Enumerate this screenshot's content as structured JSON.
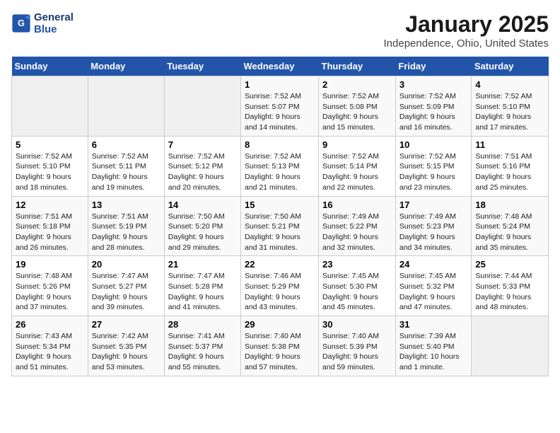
{
  "header": {
    "logo_line1": "General",
    "logo_line2": "Blue",
    "title": "January 2025",
    "subtitle": "Independence, Ohio, United States"
  },
  "days_of_week": [
    "Sunday",
    "Monday",
    "Tuesday",
    "Wednesday",
    "Thursday",
    "Friday",
    "Saturday"
  ],
  "weeks": [
    [
      {
        "num": "",
        "sunrise": "",
        "sunset": "",
        "daylight": ""
      },
      {
        "num": "",
        "sunrise": "",
        "sunset": "",
        "daylight": ""
      },
      {
        "num": "",
        "sunrise": "",
        "sunset": "",
        "daylight": ""
      },
      {
        "num": "1",
        "sunrise": "Sunrise: 7:52 AM",
        "sunset": "Sunset: 5:07 PM",
        "daylight": "Daylight: 9 hours and 14 minutes."
      },
      {
        "num": "2",
        "sunrise": "Sunrise: 7:52 AM",
        "sunset": "Sunset: 5:08 PM",
        "daylight": "Daylight: 9 hours and 15 minutes."
      },
      {
        "num": "3",
        "sunrise": "Sunrise: 7:52 AM",
        "sunset": "Sunset: 5:09 PM",
        "daylight": "Daylight: 9 hours and 16 minutes."
      },
      {
        "num": "4",
        "sunrise": "Sunrise: 7:52 AM",
        "sunset": "Sunset: 5:10 PM",
        "daylight": "Daylight: 9 hours and 17 minutes."
      }
    ],
    [
      {
        "num": "5",
        "sunrise": "Sunrise: 7:52 AM",
        "sunset": "Sunset: 5:10 PM",
        "daylight": "Daylight: 9 hours and 18 minutes."
      },
      {
        "num": "6",
        "sunrise": "Sunrise: 7:52 AM",
        "sunset": "Sunset: 5:11 PM",
        "daylight": "Daylight: 9 hours and 19 minutes."
      },
      {
        "num": "7",
        "sunrise": "Sunrise: 7:52 AM",
        "sunset": "Sunset: 5:12 PM",
        "daylight": "Daylight: 9 hours and 20 minutes."
      },
      {
        "num": "8",
        "sunrise": "Sunrise: 7:52 AM",
        "sunset": "Sunset: 5:13 PM",
        "daylight": "Daylight: 9 hours and 21 minutes."
      },
      {
        "num": "9",
        "sunrise": "Sunrise: 7:52 AM",
        "sunset": "Sunset: 5:14 PM",
        "daylight": "Daylight: 9 hours and 22 minutes."
      },
      {
        "num": "10",
        "sunrise": "Sunrise: 7:52 AM",
        "sunset": "Sunset: 5:15 PM",
        "daylight": "Daylight: 9 hours and 23 minutes."
      },
      {
        "num": "11",
        "sunrise": "Sunrise: 7:51 AM",
        "sunset": "Sunset: 5:16 PM",
        "daylight": "Daylight: 9 hours and 25 minutes."
      }
    ],
    [
      {
        "num": "12",
        "sunrise": "Sunrise: 7:51 AM",
        "sunset": "Sunset: 5:18 PM",
        "daylight": "Daylight: 9 hours and 26 minutes."
      },
      {
        "num": "13",
        "sunrise": "Sunrise: 7:51 AM",
        "sunset": "Sunset: 5:19 PM",
        "daylight": "Daylight: 9 hours and 28 minutes."
      },
      {
        "num": "14",
        "sunrise": "Sunrise: 7:50 AM",
        "sunset": "Sunset: 5:20 PM",
        "daylight": "Daylight: 9 hours and 29 minutes."
      },
      {
        "num": "15",
        "sunrise": "Sunrise: 7:50 AM",
        "sunset": "Sunset: 5:21 PM",
        "daylight": "Daylight: 9 hours and 31 minutes."
      },
      {
        "num": "16",
        "sunrise": "Sunrise: 7:49 AM",
        "sunset": "Sunset: 5:22 PM",
        "daylight": "Daylight: 9 hours and 32 minutes."
      },
      {
        "num": "17",
        "sunrise": "Sunrise: 7:49 AM",
        "sunset": "Sunset: 5:23 PM",
        "daylight": "Daylight: 9 hours and 34 minutes."
      },
      {
        "num": "18",
        "sunrise": "Sunrise: 7:48 AM",
        "sunset": "Sunset: 5:24 PM",
        "daylight": "Daylight: 9 hours and 35 minutes."
      }
    ],
    [
      {
        "num": "19",
        "sunrise": "Sunrise: 7:48 AM",
        "sunset": "Sunset: 5:26 PM",
        "daylight": "Daylight: 9 hours and 37 minutes."
      },
      {
        "num": "20",
        "sunrise": "Sunrise: 7:47 AM",
        "sunset": "Sunset: 5:27 PM",
        "daylight": "Daylight: 9 hours and 39 minutes."
      },
      {
        "num": "21",
        "sunrise": "Sunrise: 7:47 AM",
        "sunset": "Sunset: 5:28 PM",
        "daylight": "Daylight: 9 hours and 41 minutes."
      },
      {
        "num": "22",
        "sunrise": "Sunrise: 7:46 AM",
        "sunset": "Sunset: 5:29 PM",
        "daylight": "Daylight: 9 hours and 43 minutes."
      },
      {
        "num": "23",
        "sunrise": "Sunrise: 7:45 AM",
        "sunset": "Sunset: 5:30 PM",
        "daylight": "Daylight: 9 hours and 45 minutes."
      },
      {
        "num": "24",
        "sunrise": "Sunrise: 7:45 AM",
        "sunset": "Sunset: 5:32 PM",
        "daylight": "Daylight: 9 hours and 47 minutes."
      },
      {
        "num": "25",
        "sunrise": "Sunrise: 7:44 AM",
        "sunset": "Sunset: 5:33 PM",
        "daylight": "Daylight: 9 hours and 48 minutes."
      }
    ],
    [
      {
        "num": "26",
        "sunrise": "Sunrise: 7:43 AM",
        "sunset": "Sunset: 5:34 PM",
        "daylight": "Daylight: 9 hours and 51 minutes."
      },
      {
        "num": "27",
        "sunrise": "Sunrise: 7:42 AM",
        "sunset": "Sunset: 5:35 PM",
        "daylight": "Daylight: 9 hours and 53 minutes."
      },
      {
        "num": "28",
        "sunrise": "Sunrise: 7:41 AM",
        "sunset": "Sunset: 5:37 PM",
        "daylight": "Daylight: 9 hours and 55 minutes."
      },
      {
        "num": "29",
        "sunrise": "Sunrise: 7:40 AM",
        "sunset": "Sunset: 5:38 PM",
        "daylight": "Daylight: 9 hours and 57 minutes."
      },
      {
        "num": "30",
        "sunrise": "Sunrise: 7:40 AM",
        "sunset": "Sunset: 5:39 PM",
        "daylight": "Daylight: 9 hours and 59 minutes."
      },
      {
        "num": "31",
        "sunrise": "Sunrise: 7:39 AM",
        "sunset": "Sunset: 5:40 PM",
        "daylight": "Daylight: 10 hours and 1 minute."
      },
      {
        "num": "",
        "sunrise": "",
        "sunset": "",
        "daylight": ""
      }
    ]
  ]
}
